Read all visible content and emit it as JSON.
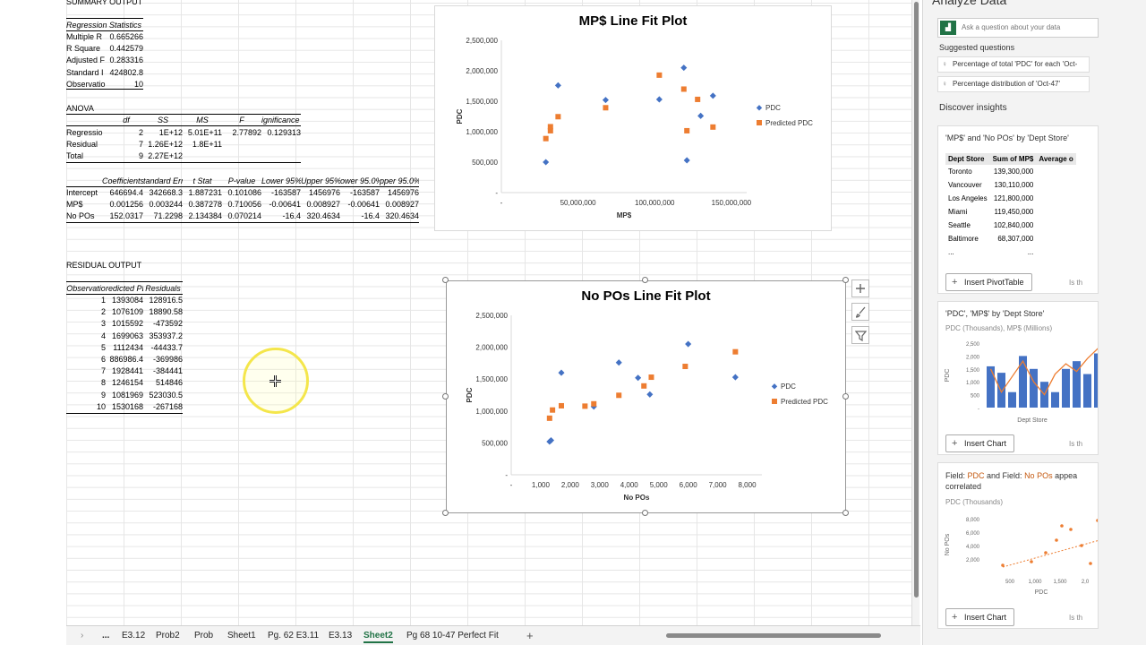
{
  "summary": {
    "title": "SUMMARY OUTPUT",
    "regression_statistics_header": "Regression Statistics",
    "stats": [
      {
        "label": "Multiple R",
        "value": "0.665266"
      },
      {
        "label": "R Square",
        "value": "0.442579"
      },
      {
        "label": "Adjusted F",
        "value": "0.283316"
      },
      {
        "label": "Standard I",
        "value": "424802.8"
      },
      {
        "label": "Observatio",
        "value": "10"
      }
    ],
    "anova_label": "ANOVA",
    "anova_headers": [
      "",
      "df",
      "SS",
      "MS",
      "F",
      "ignificance F"
    ],
    "anova_rows": [
      [
        "Regressio",
        "2",
        "1E+12",
        "5.01E+11",
        "2.77892",
        "0.129313"
      ],
      [
        "Residual",
        "7",
        "1.26E+12",
        "1.8E+11",
        "",
        ""
      ],
      [
        "Total",
        "9",
        "2.27E+12",
        "",
        "",
        ""
      ]
    ],
    "coef_headers": [
      "",
      "Coefficients",
      "tandard Erro",
      "t Stat",
      "P-value",
      "Lower 95%",
      "Upper 95%",
      "ower 95.0%",
      "pper 95.0%"
    ],
    "coef_rows": [
      [
        "Intercept",
        "646694.4",
        "342668.3",
        "1.887231",
        "0.101086",
        "-163587",
        "1456976",
        "-163587",
        "1456976"
      ],
      [
        "MP$",
        "0.001256",
        "0.003244",
        "0.387278",
        "0.710056",
        "-0.00641",
        "0.008927",
        "-0.00641",
        "0.008927"
      ],
      [
        "No POs",
        "152.0317",
        "71.2298",
        "2.134384",
        "0.070214",
        "-16.4",
        "320.4634",
        "-16.4",
        "320.4634"
      ]
    ],
    "residual_title": "RESIDUAL OUTPUT",
    "residual_headers": [
      "Observatio",
      "redicted PD",
      "Residuals"
    ],
    "residual_rows": [
      [
        "1",
        "1393084",
        "128916.5"
      ],
      [
        "2",
        "1076109",
        "18890.58"
      ],
      [
        "3",
        "1015592",
        "-473592"
      ],
      [
        "4",
        "1699063",
        "353937.2"
      ],
      [
        "5",
        "1112434",
        "-44433.7"
      ],
      [
        "6",
        "886986.4",
        "-369986"
      ],
      [
        "7",
        "1928441",
        "-384441"
      ],
      [
        "8",
        "1246154",
        "514846"
      ],
      [
        "9",
        "1081969",
        "523030.5"
      ],
      [
        "10",
        "1530168",
        "-267168"
      ]
    ]
  },
  "chart_data": [
    {
      "type": "scatter",
      "title": "MP$ Line Fit  Plot",
      "xlabel": "MP$",
      "ylabel": "PDC",
      "xlim": [
        0,
        160000000
      ],
      "ylim": [
        0,
        2500000
      ],
      "x_ticks": [
        "-",
        "50,000,000",
        "100,000,000",
        "150,000,000"
      ],
      "y_ticks": [
        "-",
        "500,000",
        "1,000,000",
        "1,500,000",
        "2,000,000",
        "2,500,000"
      ],
      "series": [
        {
          "name": "PDC",
          "color": "#4472c4",
          "marker": "diamond",
          "points": [
            [
              29000000,
              500000
            ],
            [
              37000000,
              1760000
            ],
            [
              68000000,
              1520000
            ],
            [
              103000000,
              1530000
            ],
            [
              119000000,
              2050000
            ],
            [
              121000000,
              530000
            ],
            [
              130000000,
              1260000
            ],
            [
              138000000,
              1590000
            ]
          ]
        },
        {
          "name": "Predicted PDC",
          "color": "#ed7d31",
          "marker": "square",
          "points": [
            [
              29000000,
              886986
            ],
            [
              32000000,
              1015592
            ],
            [
              32000000,
              1081969
            ],
            [
              37000000,
              1246154
            ],
            [
              68000000,
              1393084
            ],
            [
              103000000,
              1928441
            ],
            [
              119000000,
              1699063
            ],
            [
              121000000,
              1015592
            ],
            [
              128000000,
              1530168
            ],
            [
              138000000,
              1076109
            ]
          ]
        }
      ],
      "legend": "right"
    },
    {
      "type": "scatter",
      "title": "No POs Line Fit  Plot",
      "xlabel": "No POs",
      "ylabel": "PDC",
      "xlim": [
        0,
        8500
      ],
      "ylim": [
        0,
        2500000
      ],
      "x_ticks": [
        "-",
        "1,000",
        "2,000",
        "3,000",
        "4,000",
        "5,000",
        "6,000",
        "7,000",
        "8,000"
      ],
      "y_ticks": [
        "-",
        "500,000",
        "1,000,000",
        "1,500,000",
        "2,000,000",
        "2,500,000"
      ],
      "series": [
        {
          "name": "PDC",
          "color": "#4472c4",
          "marker": "diamond",
          "points": [
            [
              1300,
              520000
            ],
            [
              1350,
              540000
            ],
            [
              1700,
              1600000
            ],
            [
              2800,
              1070000
            ],
            [
              3650,
              1760000
            ],
            [
              4300,
              1520000
            ],
            [
              4700,
              1260000
            ],
            [
              6000,
              2050000
            ],
            [
              7600,
              1530000
            ]
          ]
        },
        {
          "name": "Predicted PDC",
          "color": "#ed7d31",
          "marker": "square",
          "points": [
            [
              1300,
              886986
            ],
            [
              1400,
              1015592
            ],
            [
              1700,
              1081969
            ],
            [
              2500,
              1076109
            ],
            [
              2800,
              1112434
            ],
            [
              3650,
              1246154
            ],
            [
              4500,
              1393084
            ],
            [
              4750,
              1530168
            ],
            [
              5900,
              1699063
            ],
            [
              7600,
              1928441
            ]
          ]
        }
      ],
      "legend": "right"
    }
  ],
  "tabs": {
    "items": [
      "E3.12",
      "Prob2",
      "Prob",
      "Sheet1",
      "Pg. 62 E3.11",
      "E3.13",
      "Sheet2",
      "Pg 68 10-47 Perfect Fit"
    ],
    "active": "Sheet2",
    "more": "...",
    "add": "+"
  },
  "panel": {
    "title": "Analyze Data",
    "ask_placeholder": "Ask a question about your data",
    "suggested_label": "Suggested questions",
    "suggestions": [
      "Percentage of total 'PDC' for each 'Oct-",
      "Percentage distribution of 'Oct-47'"
    ],
    "discover_label": "Discover insights",
    "card1": {
      "title": "'MP$' and 'No POs' by 'Dept Store'",
      "headers": [
        "Dept Store",
        "Sum of MP$",
        "Average o"
      ],
      "rows": [
        [
          "Toronto",
          "139,300,000"
        ],
        [
          "Vancouver",
          "130,110,000"
        ],
        [
          "Los Angeles",
          "121,800,000"
        ],
        [
          "Miami",
          "119,450,000"
        ],
        [
          "Seattle",
          "102,840,000"
        ],
        [
          "Baltimore",
          "68,307,000"
        ],
        [
          "...",
          "..."
        ]
      ],
      "button": "Insert PivotTable",
      "feedback": "Is th"
    },
    "card2": {
      "title": "'PDC', 'MP$' by 'Dept Store'",
      "subtitle": "PDC (Thousands), MP$ (Millions)",
      "y_ticks": [
        "2,500",
        "2,000",
        "1,500",
        "1,000",
        "500",
        "-"
      ],
      "ylabel": "PDC",
      "xlabel": "Dept Store",
      "bars": [
        1600,
        1350,
        600,
        2000,
        1500,
        1000,
        600,
        1500,
        1800,
        1300,
        2100
      ],
      "line": [
        1500,
        600,
        1200,
        1800,
        1000,
        500,
        1300,
        1700,
        1400,
        1900,
        2300
      ],
      "button": "Insert Chart",
      "feedback": "Is th"
    },
    "card3": {
      "title_prefix": "Field: ",
      "title_field1": "PDC",
      "title_mid": " and Field: ",
      "title_field2": "No POs",
      "title_suffix": " appea",
      "title_line2": "correlated",
      "subtitle": "PDC (Thousands)",
      "y_ticks": [
        "8,000",
        "6,000",
        "4,000",
        "2,000"
      ],
      "x_ticks": [
        "500",
        "1,000",
        "1,500",
        "2,0"
      ],
      "ylabel": "No POs",
      "xlabel": "PDC",
      "button": "Insert Chart",
      "feedback": "Is th"
    }
  }
}
